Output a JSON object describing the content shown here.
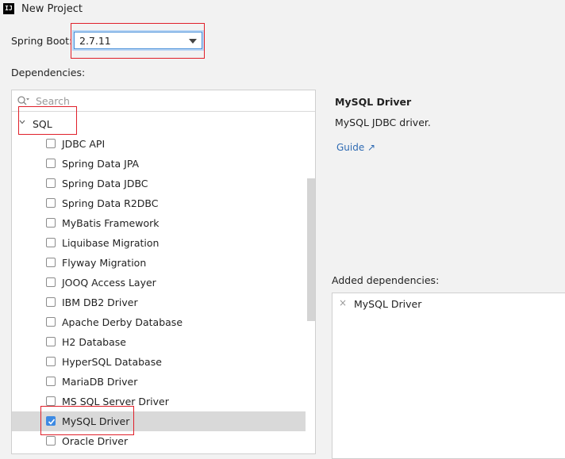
{
  "window": {
    "title": "New Project",
    "app_icon": "IJ"
  },
  "spring_boot": {
    "label": "Spring Boot:",
    "value": "2.7.11"
  },
  "dependencies": {
    "label": "Dependencies:"
  },
  "search": {
    "placeholder": "Search"
  },
  "category": {
    "name": "SQL"
  },
  "items": [
    {
      "label": "JDBC API",
      "checked": false
    },
    {
      "label": "Spring Data JPA",
      "checked": false
    },
    {
      "label": "Spring Data JDBC",
      "checked": false
    },
    {
      "label": "Spring Data R2DBC",
      "checked": false
    },
    {
      "label": "MyBatis Framework",
      "checked": false
    },
    {
      "label": "Liquibase Migration",
      "checked": false
    },
    {
      "label": "Flyway Migration",
      "checked": false
    },
    {
      "label": "JOOQ Access Layer",
      "checked": false
    },
    {
      "label": "IBM DB2 Driver",
      "checked": false
    },
    {
      "label": "Apache Derby Database",
      "checked": false
    },
    {
      "label": "H2 Database",
      "checked": false
    },
    {
      "label": "HyperSQL Database",
      "checked": false
    },
    {
      "label": "MariaDB Driver",
      "checked": false
    },
    {
      "label": "MS SQL Server Driver",
      "checked": false
    },
    {
      "label": "MySQL Driver",
      "checked": true
    },
    {
      "label": "Oracle Driver",
      "checked": false
    }
  ],
  "info": {
    "title": "MySQL Driver",
    "description": "MySQL JDBC driver.",
    "guide_link": "Guide ↗"
  },
  "added": {
    "label": "Added dependencies:",
    "items": [
      "MySQL Driver"
    ],
    "remove_symbol": "×"
  },
  "colors": {
    "highlight": "#e0202a",
    "accent": "#3d8ae3",
    "link": "#2f6bb3"
  }
}
